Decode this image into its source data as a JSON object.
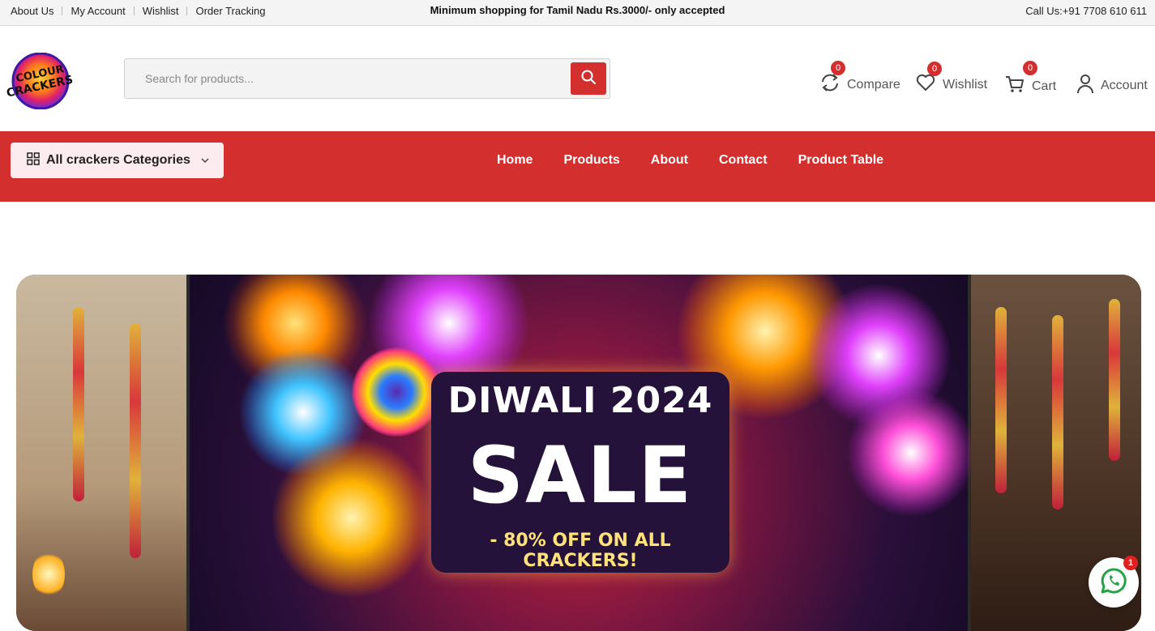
{
  "topbar": {
    "links": [
      "About Us",
      "My Account",
      "Wishlist",
      "Order Tracking"
    ],
    "notice": "Minimum shopping for Tamil Nadu Rs.3000/- only accepted",
    "phone": "Call Us:+91 7708 610 611"
  },
  "header": {
    "logo_text": "COLOUR CRACKERS",
    "search_placeholder": "Search for products...",
    "actions": {
      "compare": {
        "label": "Compare",
        "count": "0"
      },
      "wishlist": {
        "label": "Wishlist",
        "count": "0"
      },
      "cart": {
        "label": "Cart",
        "count": "0"
      },
      "account": {
        "label": "Account"
      }
    }
  },
  "nav": {
    "categories_label": "All crackers Categories",
    "links": [
      "Home",
      "Products",
      "About",
      "Contact",
      "Product Table"
    ]
  },
  "banner": {
    "line1": "DIWALI 2024",
    "line2": "SALE",
    "line3": "- 80% OFF ON ALL CRACKERS!"
  },
  "whatsapp": {
    "badge": "1"
  },
  "colors": {
    "accent": "#d32f2f",
    "category_bg": "#fdecef",
    "topbar_bg": "#f4f4f4"
  }
}
